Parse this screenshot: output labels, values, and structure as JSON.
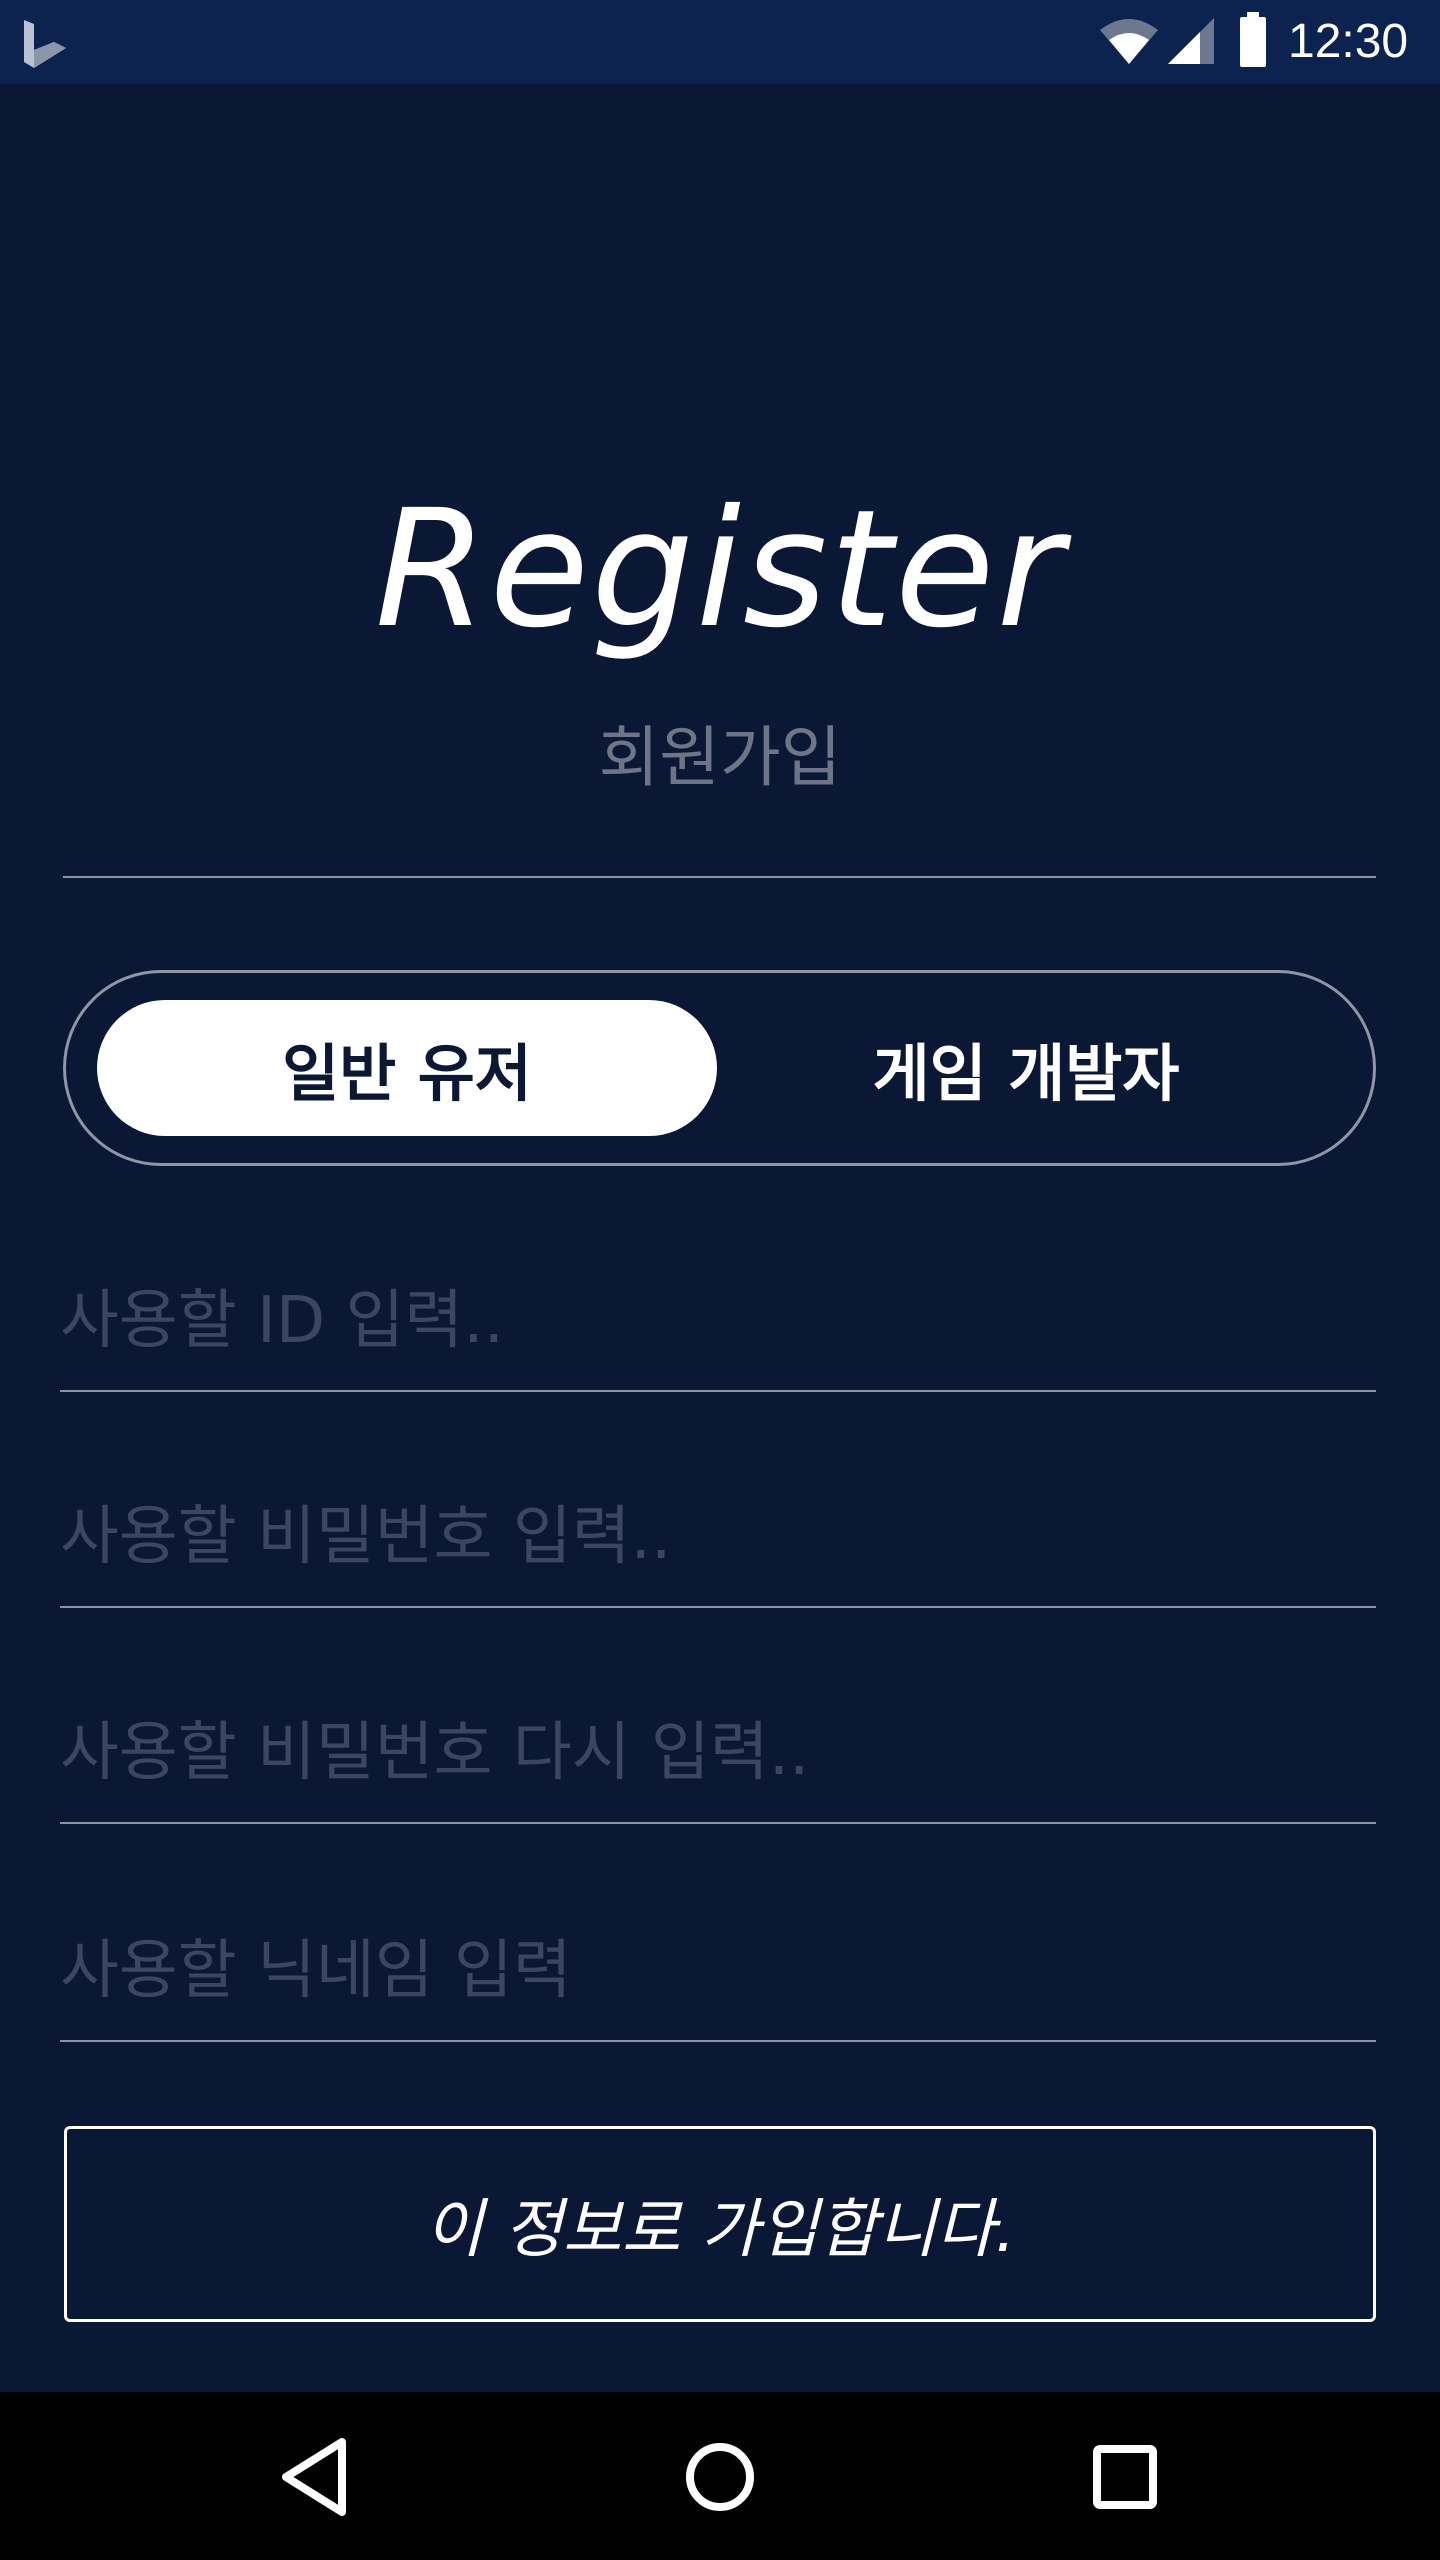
{
  "status_bar": {
    "time": "12:30",
    "icons": [
      "app-logo-icon",
      "wifi-icon",
      "cell-signal-icon",
      "battery-icon"
    ]
  },
  "header": {
    "title": "Register",
    "subtitle": "회원가입"
  },
  "user_type_toggle": {
    "options": [
      {
        "label": "일반 유저",
        "selected": true
      },
      {
        "label": "게임 개발자",
        "selected": false
      }
    ]
  },
  "form": {
    "id_placeholder": "사용할 ID 입력..",
    "password_placeholder": "사용할 비밀번호 입력..",
    "password_confirm_placeholder": "사용할 비밀번호 다시 입력..",
    "nickname_placeholder": "사용할 닉네임 입력",
    "submit_label": "이 정보로 가입합니다."
  },
  "nav_bar": {
    "icons": [
      "back-icon",
      "home-icon",
      "recent-apps-icon"
    ]
  },
  "colors": {
    "background": "#0b1835",
    "status_bar": "#0c2350",
    "divider": "#8b92a3",
    "placeholder": "#3c4660",
    "subtitle": "#6e7587",
    "text": "#ffffff"
  }
}
